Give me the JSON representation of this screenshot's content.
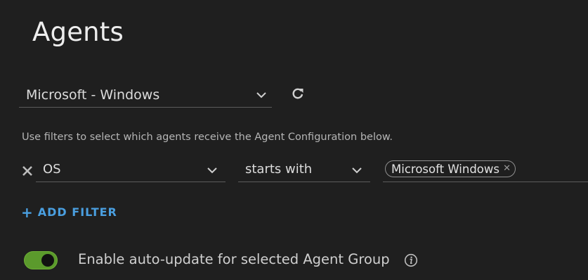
{
  "page": {
    "title": "Agents"
  },
  "group_select": {
    "value": "Microsoft - Windows",
    "chevron_icon": "chevron-down-icon",
    "refresh_icon": "refresh-icon"
  },
  "filters": {
    "help_text": "Use filters to select which agents receive the Agent Configuration below.",
    "rows": [
      {
        "attribute": "OS",
        "operator": "starts with",
        "values": [
          "Microsoft Windows"
        ]
      }
    ],
    "add_filter_plus": "+",
    "add_filter_label": "ADD FILTER"
  },
  "auto_update": {
    "enabled": true,
    "label": "Enable auto-update for selected Agent Group",
    "info_icon": "info-icon"
  },
  "colors": {
    "background": "#1f1f1f",
    "accent_link": "#4a9fe0",
    "toggle_on": "#5b9a2c"
  }
}
